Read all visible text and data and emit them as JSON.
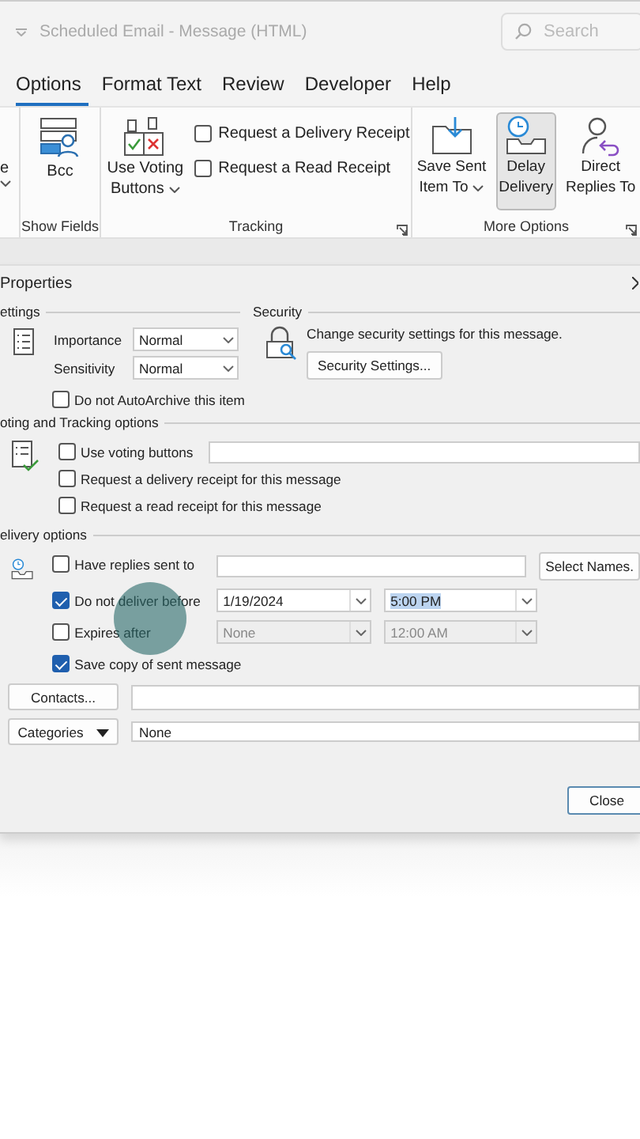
{
  "title_bar": {
    "title": "Scheduled Email  -  Message (HTML)",
    "search_placeholder": "Search"
  },
  "tabs": [
    {
      "label": "Options",
      "selected": true
    },
    {
      "label": "Format Text",
      "selected": false
    },
    {
      "label": "Review",
      "selected": false
    },
    {
      "label": "Developer",
      "selected": false
    },
    {
      "label": "Help",
      "selected": false
    }
  ],
  "ribbon": {
    "cut_group_label": "e",
    "show_fields": {
      "label": "Show Fields",
      "button": "Bcc"
    },
    "tracking": {
      "label": "Tracking",
      "voting_lines": [
        "Use Voting",
        "Buttons"
      ],
      "checks": [
        {
          "label": "Request a Delivery Receipt",
          "checked": false
        },
        {
          "label": "Request a Read Receipt",
          "checked": false
        }
      ]
    },
    "more_options": {
      "label": "More Options",
      "buttons": [
        {
          "kind": "save",
          "lines": [
            "Save Sent",
            "Item To"
          ],
          "dropdown": true,
          "selected": false
        },
        {
          "kind": "delay",
          "lines": [
            "Delay",
            "Delivery"
          ],
          "dropdown": false,
          "selected": true
        },
        {
          "kind": "replies",
          "lines": [
            "Direct",
            "Replies To"
          ],
          "dropdown": false,
          "selected": false
        }
      ]
    }
  },
  "dialog": {
    "title": "Properties",
    "settings": {
      "header": "ettings",
      "importance_label": "Importance",
      "importance": "Normal",
      "sensitivity_label": "Sensitivity",
      "sensitivity": "Normal",
      "autoarchive": {
        "label": "Do not AutoArchive this item",
        "checked": false
      }
    },
    "security": {
      "header": "Security",
      "text": "Change security settings for this message.",
      "button": "Security Settings..."
    },
    "voting": {
      "header": "oting and Tracking options",
      "checks": [
        {
          "label": "Use voting buttons",
          "checked": false
        },
        {
          "label": "Request a delivery receipt for this message",
          "checked": false
        },
        {
          "label": "Request a read receipt for this message",
          "checked": false
        }
      ]
    },
    "delivery": {
      "header": "elivery options",
      "replies": {
        "label": "Have replies sent to",
        "checked": false,
        "button": "Select Names."
      },
      "deliver_before": {
        "label": "Do not deliver before",
        "checked": true,
        "date": "1/19/2024",
        "time": "5:00 PM"
      },
      "expires": {
        "label": "Expires after",
        "checked": false,
        "date": "None",
        "time": "12:00 AM"
      },
      "save_copy": {
        "label": "Save copy of sent message",
        "checked": true
      }
    },
    "contacts_button": "Contacts...",
    "categories_button": "Categories",
    "categories_value": "None",
    "close_button": "Close"
  }
}
